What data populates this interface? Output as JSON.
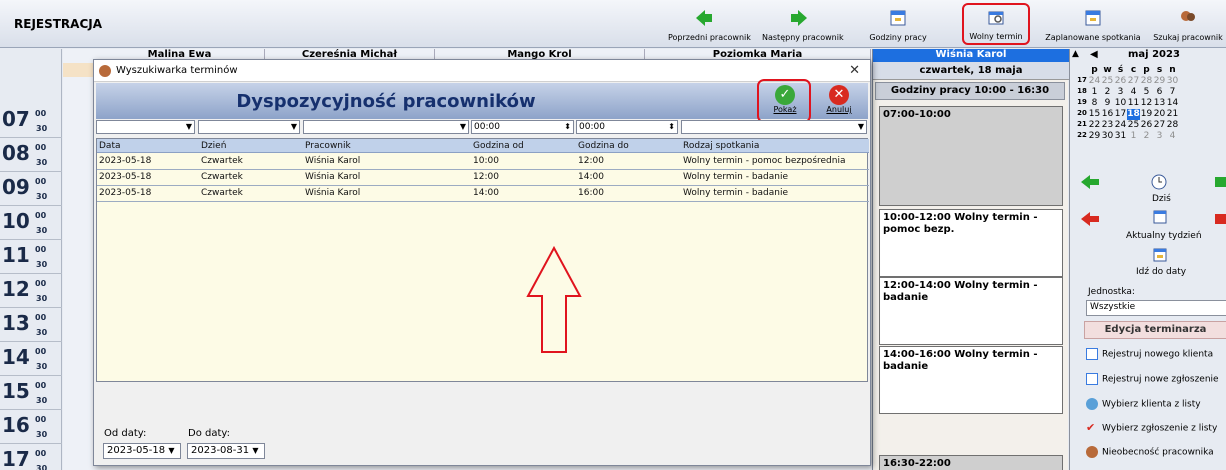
{
  "app": {
    "title": "REJESTRACJA"
  },
  "toolbar": {
    "prev_employee": "Poprzedni pracownik",
    "next_employee": "Następny pracownik",
    "work_hours": "Godziny pracy",
    "free_slot": "Wolny termin",
    "planned_meetings": "Zaplanowane spotkania",
    "search_employee": "Szukaj pracownik"
  },
  "employees": [
    "Malina Ewa",
    "Czereśnia Michał",
    "Mango Krol",
    "Poziomka Maria"
  ],
  "times": {
    "hours": [
      "07",
      "08",
      "09",
      "10",
      "11",
      "12",
      "13",
      "14",
      "15",
      "16",
      "17"
    ],
    "minutes_top": "00",
    "minutes_half": "30"
  },
  "day_view": {
    "employee": "Wiśnia Karol",
    "date": "czwartek, 18 maja",
    "work_hours": "Godziny pracy 10:00 - 16:30",
    "slots": [
      "07:00-10:00",
      "10:00-12:00 Wolny termin - pomoc bezp.",
      "12:00-14:00 Wolny termin - badanie",
      "14:00-16:00 Wolny termin - badanie",
      "16:30-22:00"
    ]
  },
  "calendar": {
    "month": "maj 2023",
    "weekdays": [
      "p",
      "w",
      "ś",
      "c",
      "p",
      "s",
      "n"
    ],
    "weeks": [
      {
        "wk": "17",
        "days": [
          "24",
          "25",
          "26",
          "27",
          "28",
          "29",
          "30"
        ]
      },
      {
        "wk": "18",
        "days": [
          "1",
          "2",
          "3",
          "4",
          "5",
          "6",
          "7"
        ]
      },
      {
        "wk": "19",
        "days": [
          "8",
          "9",
          "10",
          "11",
          "12",
          "13",
          "14"
        ]
      },
      {
        "wk": "20",
        "days": [
          "15",
          "16",
          "17",
          "18",
          "19",
          "20",
          "21"
        ]
      },
      {
        "wk": "21",
        "days": [
          "22",
          "23",
          "24",
          "25",
          "26",
          "27",
          "28"
        ]
      },
      {
        "wk": "22",
        "days": [
          "29",
          "30",
          "31",
          "1",
          "2",
          "3",
          "4"
        ]
      }
    ],
    "today_label": "Dziś",
    "current_week": "Aktualny tydzień",
    "go_to_date": "Idź do daty"
  },
  "right_panel": {
    "unit_label": "Jednostka:",
    "unit_value": "Wszystkie",
    "section": "Edycja terminarza",
    "items": [
      "Rejestruj nowego klienta",
      "Rejestruj nowe zgłoszenie",
      "Wybierz klienta z listy",
      "Wybierz zgłoszenie z listy",
      "Nieobecność pracownika"
    ]
  },
  "modal": {
    "title": "Wyszukiwarka terminów",
    "heading": "Dyspozycyjność pracowników",
    "show_label": "Pokaż",
    "cancel_label": "Anuluj",
    "filters": {
      "from_time": "00:00",
      "to_time": "00:00"
    },
    "columns": [
      "Data",
      "Dzień",
      "Pracownik",
      "Godzina od",
      "Godzina do",
      "Rodzaj spotkania"
    ],
    "rows": [
      [
        "2023-05-18",
        "Czwartek",
        "Wiśnia Karol",
        "10:00",
        "12:00",
        "Wolny termin - pomoc bezpośrednia"
      ],
      [
        "2023-05-18",
        "Czwartek",
        "Wiśnia Karol",
        "12:00",
        "14:00",
        "Wolny termin - badanie"
      ],
      [
        "2023-05-18",
        "Czwartek",
        "Wiśnia Karol",
        "14:00",
        "16:00",
        "Wolny termin - badanie"
      ]
    ],
    "from_date_label": "Od daty:",
    "to_date_label": "Do daty:",
    "from_date": "2023-05-18",
    "to_date": "2023-08-31"
  }
}
